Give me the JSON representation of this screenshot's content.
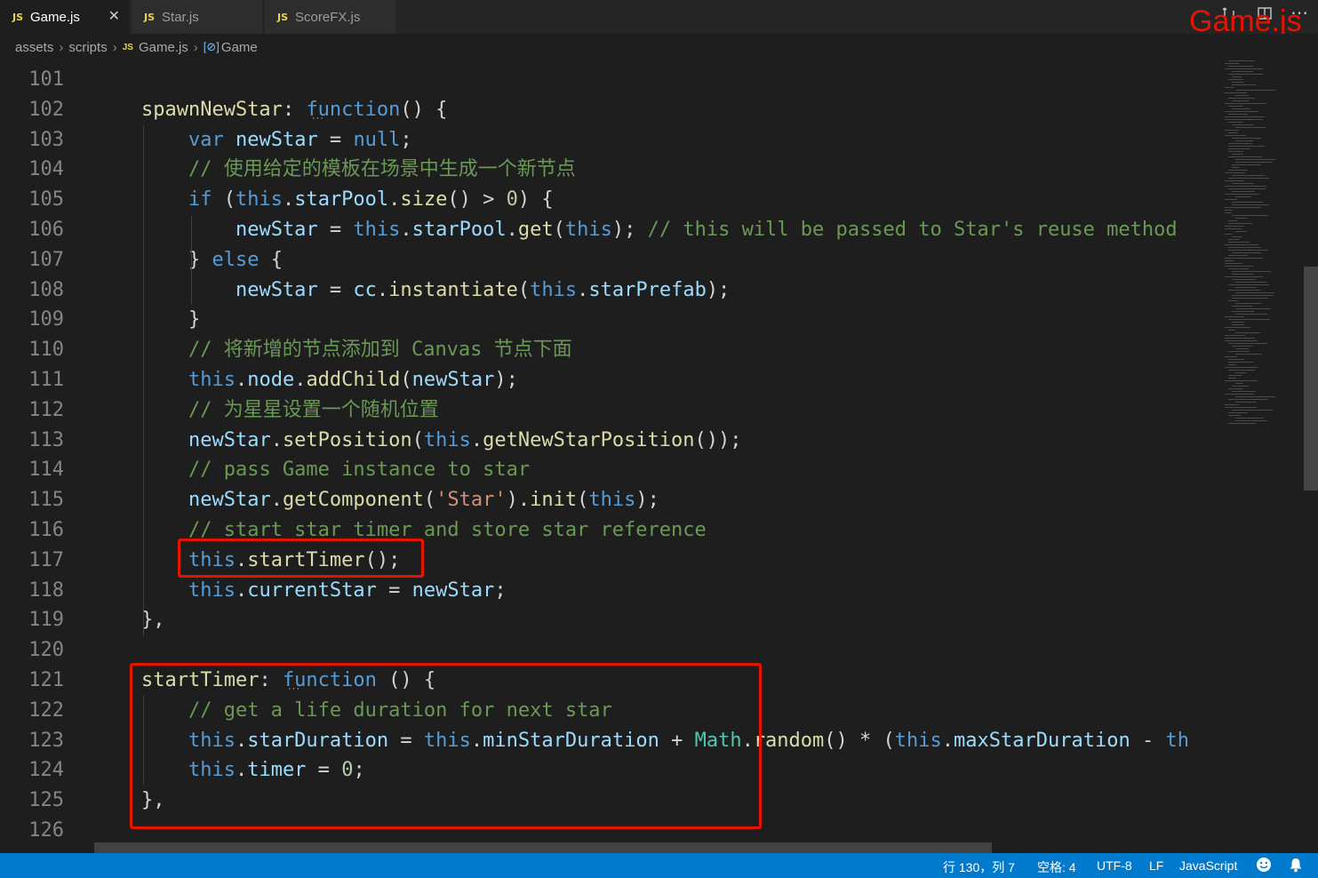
{
  "tabs": [
    {
      "icon": "JS",
      "label": "Game.js",
      "active": true,
      "close": "✕"
    },
    {
      "icon": "JS",
      "label": "Star.js",
      "active": false
    },
    {
      "icon": "JS",
      "label": "ScoreFX.js",
      "active": false
    }
  ],
  "title_overlay": "Game.js",
  "breadcrumb": {
    "items": [
      "assets",
      "scripts",
      "Game.js",
      "Game"
    ],
    "file_icon": "JS",
    "symbol_icon": "[⊘]"
  },
  "line_numbers": [
    "101",
    "102",
    "103",
    "104",
    "105",
    "106",
    "107",
    "108",
    "109",
    "110",
    "111",
    "112",
    "113",
    "114",
    "115",
    "116",
    "117",
    "118",
    "119",
    "120",
    "121",
    "122",
    "123",
    "124",
    "125",
    "126"
  ],
  "code": {
    "l102": {
      "name": "spawnNewStar",
      "colon": ": ",
      "kw": "function",
      "rest": "() {"
    },
    "l103": {
      "kw": "var",
      "name": "newStar",
      "eq": " = ",
      "val": "null",
      "end": ";"
    },
    "l104": "// 使用给定的模板在场景中生成一个新节点",
    "l105": {
      "kw": "if",
      "open": " (",
      "this": "this",
      "prop": "starPool",
      "fn": "size",
      "rest": "() > ",
      "num": "0",
      "end": ") {"
    },
    "l106": {
      "var": "newStar",
      "eq": " = ",
      "this": "this",
      "prop": "starPool",
      "fn": "get",
      "arg": "this",
      "end": "); ",
      "comment": "// this will be passed to Star's reuse method"
    },
    "l107": {
      "close": "} ",
      "kw": "else",
      "rest": " {"
    },
    "l108": {
      "var": "newStar",
      "eq": " = ",
      "obj": "cc",
      "fn": "instantiate",
      "this": "this",
      "prop": "starPrefab",
      "end": ");"
    },
    "l109": "}",
    "l110": "// 将新增的节点添加到 Canvas 节点下面",
    "l111": {
      "this": "this",
      "prop": "node",
      "fn": "addChild",
      "arg": "newStar",
      "end": ");"
    },
    "l112": "// 为星星设置一个随机位置",
    "l113": {
      "var": "newStar",
      "fn": "setPosition",
      "this": "this",
      "fn2": "getNewStarPosition",
      "end": "());"
    },
    "l114": "// pass Game instance to star",
    "l115": {
      "var": "newStar",
      "fn": "getComponent",
      "str": "'Star'",
      "fn2": "init",
      "this": "this",
      "end": ");"
    },
    "l116": "// start star timer and store star reference",
    "l117": {
      "this": "this",
      "fn": "startTimer",
      "end": "();"
    },
    "l118": {
      "this": "this",
      "prop": "currentStar",
      "eq": " = ",
      "var": "newStar",
      "end": ";"
    },
    "l119": "},",
    "l121": {
      "name": "startTimer",
      "colon": ": ",
      "kw": "function",
      "rest": " () {"
    },
    "l122": "// get a life duration for next star",
    "l123": {
      "this": "this",
      "prop": "starDuration",
      "eq": " = ",
      "this2": "this",
      "prop2": "minStarDuration",
      "plus": " + ",
      "cls": "Math",
      "fn": "random",
      "mid": "() * (",
      "this3": "this",
      "prop3": "maxStarDuration",
      "minus": " - ",
      "trail": "th"
    },
    "l124": {
      "this": "this",
      "prop": "timer",
      "eq": " = ",
      "num": "0",
      "end": ";"
    },
    "l125": "},"
  },
  "status": {
    "position": "行 130，列 7",
    "spaces": "空格: 4",
    "encoding": "UTF-8",
    "eol": "LF",
    "language": "JavaScript"
  },
  "colors": {
    "highlight_box": "#e51400",
    "statusbar": "#007acc"
  },
  "icons": [
    "close-icon",
    "compare-icon",
    "split-editor-icon",
    "more-icon",
    "feedback-smiley-icon",
    "bell-icon"
  ]
}
